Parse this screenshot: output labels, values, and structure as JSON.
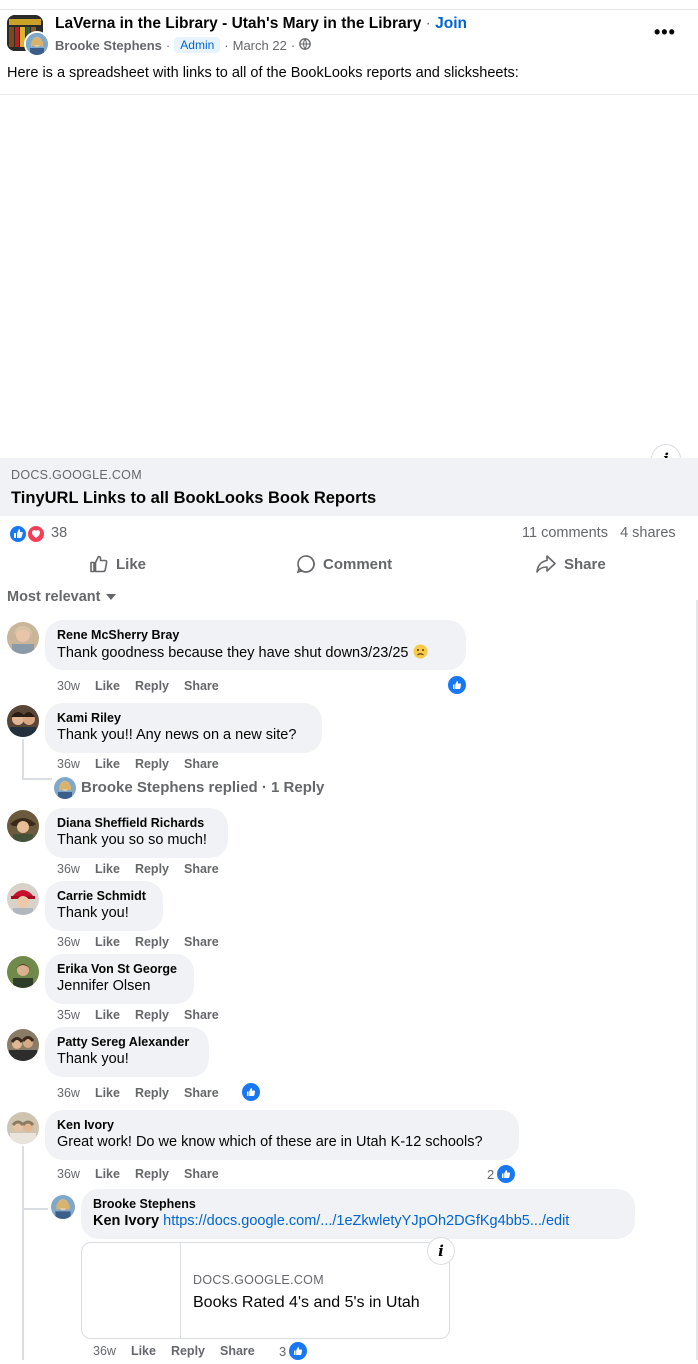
{
  "post": {
    "group_title": "LaVerna in the Library - Utah's Mary in the Library",
    "join_label": "Join",
    "separator": "·",
    "author": "Brooke Stephens",
    "author_badge": "Admin",
    "date": "March 22",
    "text": "Here is a spreadsheet with links to all of the BookLooks reports and slicksheets:",
    "more_label": "•••"
  },
  "link_preview": {
    "domain": "DOCS.GOOGLE.COM",
    "title": "TinyURL Links to all BookLooks Book Reports"
  },
  "reactions": {
    "count": "38",
    "comments": "11 comments",
    "shares": "4 shares"
  },
  "actions": {
    "like": "Like",
    "comment": "Comment",
    "share": "Share"
  },
  "sort_label": "Most relevant",
  "comment_actions": {
    "like": "Like",
    "reply": "Reply",
    "share": "Share"
  },
  "comments": [
    {
      "name": "Rene McSherry Bray",
      "text": "Thank goodness because they have shut down3/23/25",
      "time": "30w"
    },
    {
      "name": "Kami Riley",
      "text": "Thank you!! Any news on a new site?",
      "time": "36w",
      "replies_summary": "Brooke Stephens replied · 1 Reply"
    },
    {
      "name": "Diana Sheffield Richards",
      "text": "Thank you so so much!",
      "time": "36w"
    },
    {
      "name": "Carrie Schmidt",
      "text": "Thank you!",
      "time": "36w"
    },
    {
      "name": "Erika Von St George",
      "text": "Jennifer Olsen",
      "time": "35w"
    },
    {
      "name": "Patty Sereg Alexander",
      "text": "Thank you!",
      "time": "36w"
    },
    {
      "name": "Ken Ivory",
      "text": "Great work! Do we know which of these are in Utah K-12 schools?",
      "time": "36w",
      "like_count": "2"
    }
  ],
  "reply": {
    "name": "Brooke Stephens",
    "mention": "Ken Ivory",
    "link": "https://docs.google.com/.../1eZkwletyYJpOh2DGfKg4bb5.../edit",
    "time": "36w",
    "like_count": "3",
    "preview": {
      "domain": "DOCS.GOOGLE.COM",
      "title": "Books Rated 4's and 5's in Utah"
    }
  },
  "colors": {
    "brand_blue": "#1877f2",
    "link_blue": "#0064d1",
    "love_red": "#f33e58",
    "bubble_gray": "#f0f2f5",
    "meta_gray": "#65676b"
  }
}
